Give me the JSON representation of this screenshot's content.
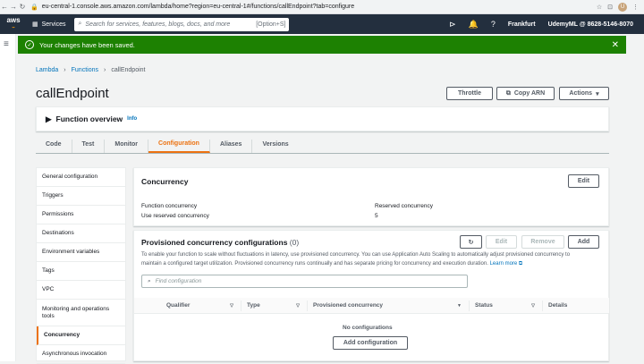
{
  "browser": {
    "url": "eu-central-1.console.aws.amazon.com/lambda/home?region=eu-central-1#/functions/callEndpoint?tab=configure",
    "avatar": "U"
  },
  "topbar": {
    "logo": "aws",
    "services": "Services",
    "search_placeholder": "Search for services, features, blogs, docs, and more",
    "shortcut": "[Option+S]",
    "region": "Frankfurt",
    "account": "UdemyML @ 8628-5146-8070"
  },
  "flash": {
    "message": "Your changes have been saved."
  },
  "breadcrumb": {
    "items": [
      "Lambda",
      "Functions",
      "callEndpoint"
    ]
  },
  "page": {
    "title": "callEndpoint",
    "throttle": "Throttle",
    "copy_arn": "Copy ARN",
    "actions": "Actions"
  },
  "overview": {
    "title": "Function overview",
    "info": "Info"
  },
  "tabs": [
    "Code",
    "Test",
    "Monitor",
    "Configuration",
    "Aliases",
    "Versions"
  ],
  "sidebar": {
    "items": [
      "General configuration",
      "Triggers",
      "Permissions",
      "Destinations",
      "Environment variables",
      "Tags",
      "VPC",
      "Monitoring and operations tools",
      "Concurrency",
      "Asynchronous invocation"
    ]
  },
  "concurrency": {
    "title": "Concurrency",
    "edit": "Edit",
    "function_concurrency": "Function concurrency",
    "use_reserved": "Use reserved concurrency",
    "reserved_label": "Reserved concurrency",
    "reserved_value": "5"
  },
  "provisioned": {
    "title": "Provisioned concurrency configurations",
    "count": "(0)",
    "edit": "Edit",
    "remove": "Remove",
    "add": "Add",
    "description": "To enable your function to scale without fluctuations in latency, use provisioned concurrency. You can use Application Auto Scaling to automatically adjust provisioned concurrency to maintain a configured target utilization. Provisioned concurrency runs continually and has separate pricing for concurrency and execution duration.",
    "learn_more": "Learn more",
    "search_placeholder": "Find configuration",
    "columns": [
      "Qualifier",
      "Type",
      "Provisioned concurrency",
      "Status",
      "Details"
    ],
    "empty": "No configurations",
    "add_configuration": "Add configuration"
  }
}
